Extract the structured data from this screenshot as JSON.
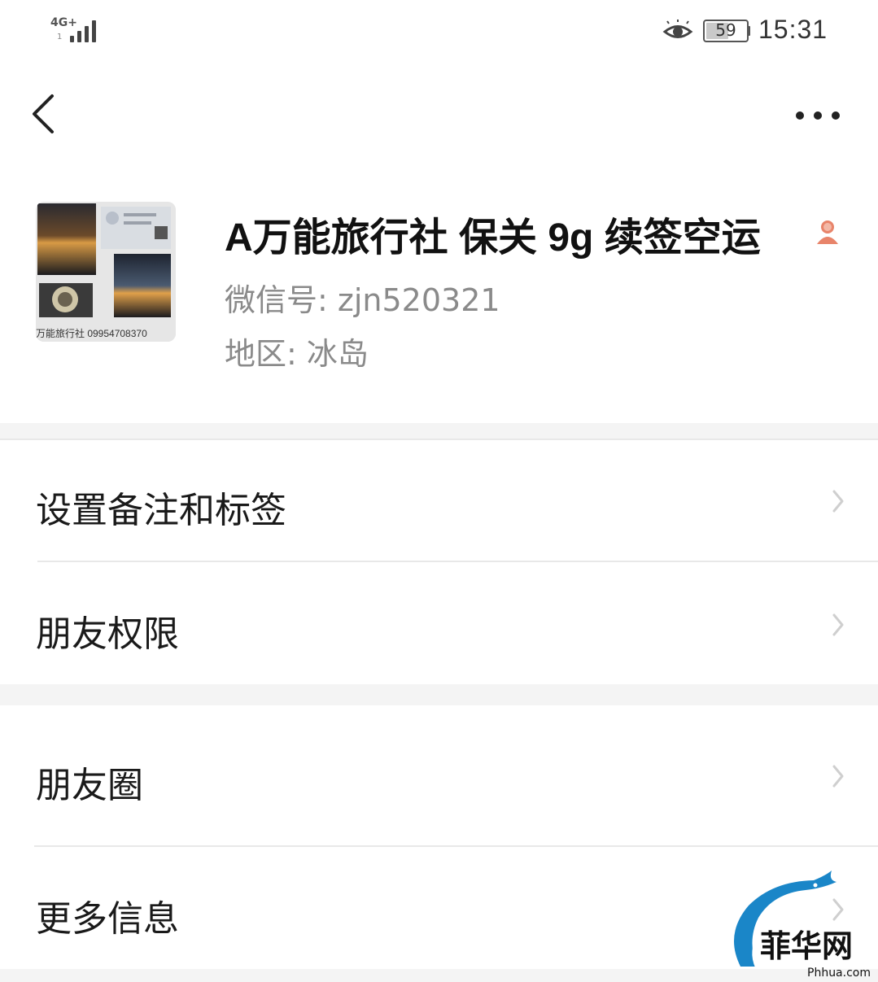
{
  "status_bar": {
    "network": "4G+",
    "network_sub": "1",
    "battery": "59",
    "time": "15:31",
    "icons": [
      "signal-icon",
      "eye-icon",
      "battery-icon"
    ]
  },
  "header": {
    "back_icon": "chevron-left-icon",
    "more_icon": "ellipsis-icon"
  },
  "profile": {
    "avatar_caption": "万能旅行社 09954708370",
    "name": "A万能旅行社  保关 9g 续签空运",
    "gender_icon": "female-icon",
    "wechat_id_label": "微信号:",
    "wechat_id": "zjn520321",
    "region_label": "地区:",
    "region": "冰岛"
  },
  "menu_group_1": [
    {
      "label": "设置备注和标签"
    },
    {
      "label": "朋友权限"
    }
  ],
  "menu_group_2": [
    {
      "label": "朋友圈"
    },
    {
      "label": "更多信息"
    }
  ],
  "watermark": {
    "logo_text": "菲华网",
    "site": "Phhua.com"
  },
  "colors": {
    "background": "#ffffff",
    "separator": "#f4f4f4",
    "secondary_text": "#8a8a8a",
    "watermark_blue": "#1a86c8",
    "gender_orange": "#e8846a"
  }
}
